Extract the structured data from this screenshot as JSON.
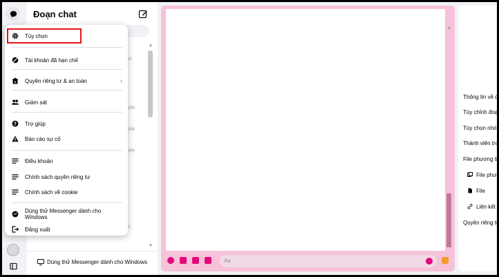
{
  "panel": {
    "title": "Đoạn chat",
    "stubs": [
      "giờ",
      "ngày",
      "ngày",
      "ngày",
      "ần"
    ],
    "footer_label": "Dùng thử Messenger dành cho Windows"
  },
  "menu": {
    "items": [
      {
        "label": "Tùy chọn",
        "icon": "gear-icon"
      },
      {
        "label": "Tài khoản đã hạn chế",
        "icon": "restricted-account-icon"
      },
      {
        "label": "Quyền riêng tư & an toàn",
        "icon": "privacy-lock-icon"
      },
      {
        "label": "Giám sát",
        "icon": "supervision-people-icon"
      },
      {
        "label": "Trợ giúp",
        "icon": "help-icon"
      },
      {
        "label": "Báo cáo sự cố",
        "icon": "warning-icon"
      },
      {
        "label": "Điều khoản",
        "icon": "document-lines-icon"
      },
      {
        "label": "Chính sách quyền riêng tư",
        "icon": "document-lines-icon"
      },
      {
        "label": "Chính sách về cookie",
        "icon": "document-lines-icon"
      },
      {
        "label": "Dùng thử Messenger dành cho Windows",
        "icon": "messenger-icon"
      },
      {
        "label": "Đăng xuất",
        "icon": "logout-icon"
      }
    ],
    "submenu_glyph": "›"
  },
  "composer": {
    "placeholder": "Aa"
  },
  "info": {
    "rows": [
      "Thông tin về đoạn chat",
      "Tùy chỉnh đoạn chat",
      "Tùy chọn nhóm",
      "Thành viên trong đoạn chat",
      "File phương tiện, file và liên kết"
    ],
    "sub": [
      "File phương tiện",
      "File",
      "Liên kết"
    ],
    "bottom": "Quyền riêng tư và hỗ trợ"
  },
  "colors": {
    "accent": "#e4087a",
    "conversation_bg": "#f6c2d9",
    "highlight_border": "#e5121b"
  }
}
